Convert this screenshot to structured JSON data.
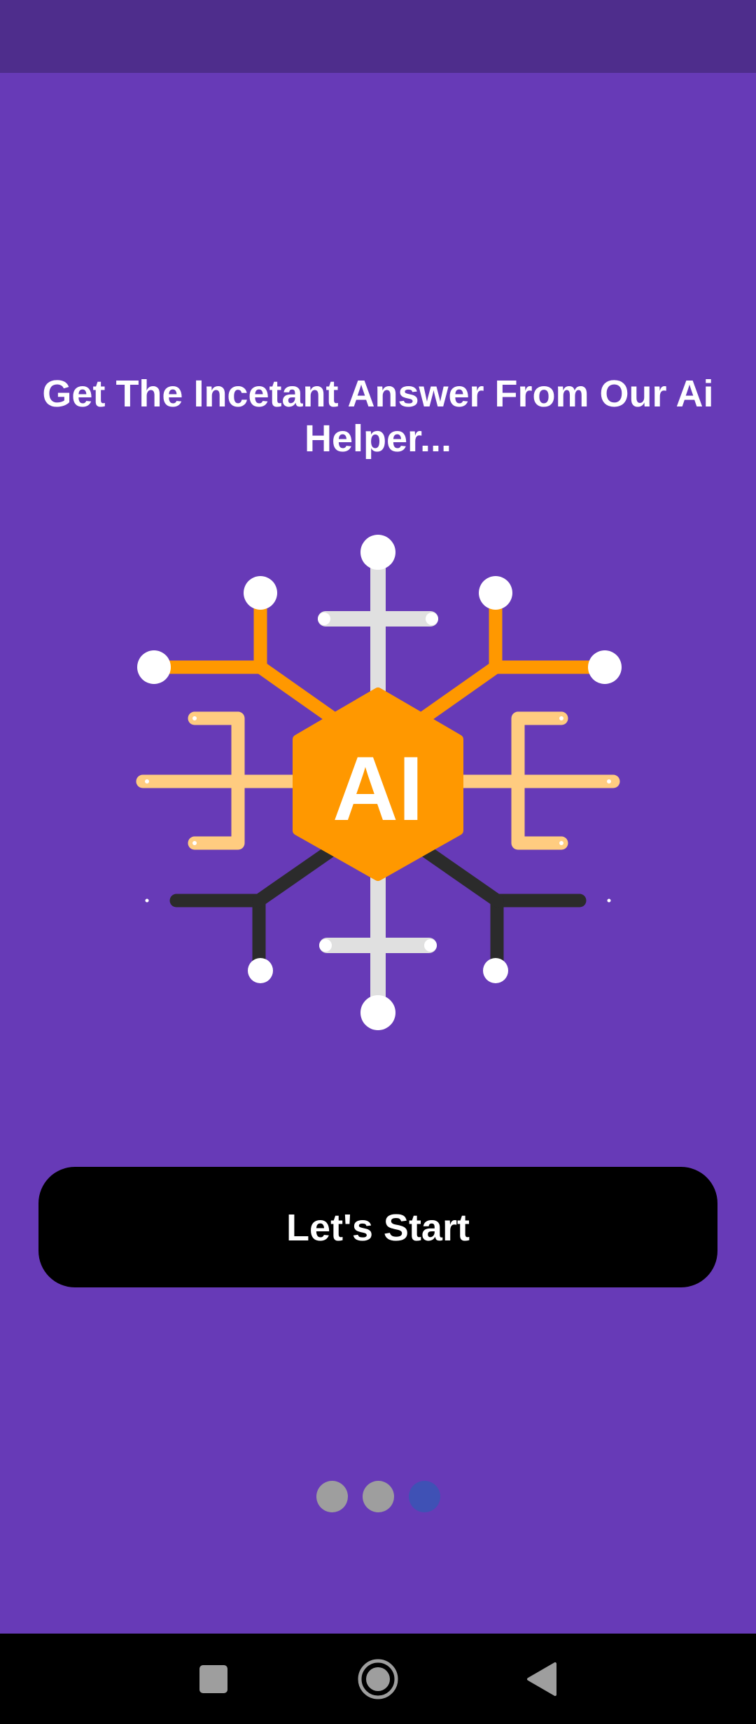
{
  "screen": {
    "headline": "Get The Incetant Answer From Our Ai Helper...",
    "illustration": {
      "center_label": "AI",
      "icon": "ai-network-icon"
    },
    "start_button": {
      "label": "Let's Start"
    },
    "pagination": {
      "total": 3,
      "active_index": 2
    }
  },
  "system_nav": {
    "recents_icon": "square-icon",
    "home_icon": "circle-home-icon",
    "back_icon": "triangle-back-icon"
  },
  "colors": {
    "background": "#673ab7",
    "status_bar": "#4e2d8c",
    "button_bg": "#000000",
    "accent_orange": "#ff9800",
    "light_orange": "#ffcc80",
    "dot_inactive": "#9e9e9e",
    "dot_active": "#3f51b5"
  }
}
